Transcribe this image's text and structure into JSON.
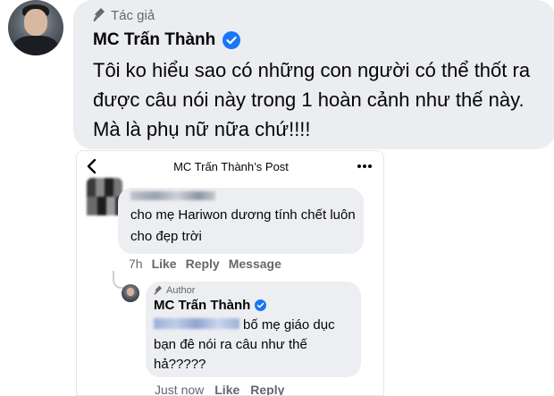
{
  "main_comment": {
    "author_badge": "Tác giả",
    "name": "MC Trấn Thành",
    "text": "Tôi ko hiểu sao có những con người có thể thốt ra được câu nói này trong 1 hoàn cảnh như thế này. Mà là phụ nữ nữa chứ!!!!"
  },
  "embedded_post": {
    "title": "MC Trấn Thành’s Post",
    "comment": {
      "text": "cho mẹ Hariwon dương tính chết luôn cho đẹp trời",
      "time": "7h",
      "actions": [
        "Like",
        "Reply",
        "Message"
      ]
    },
    "reply": {
      "author_badge": "Author",
      "name": "MC Trấn Thành",
      "text": "bố mẹ giáo dục bạn đê nói ra câu như thế hả?????",
      "time": "Just now",
      "actions": [
        "Like",
        "Reply"
      ]
    }
  },
  "colors": {
    "bubble": "#ebedf0",
    "verified_blue": "#1877f2",
    "muted_text": "#65676b"
  },
  "icons": [
    "microphone-icon",
    "verified-badge-icon",
    "back-chevron-icon",
    "more-dots-icon"
  ]
}
